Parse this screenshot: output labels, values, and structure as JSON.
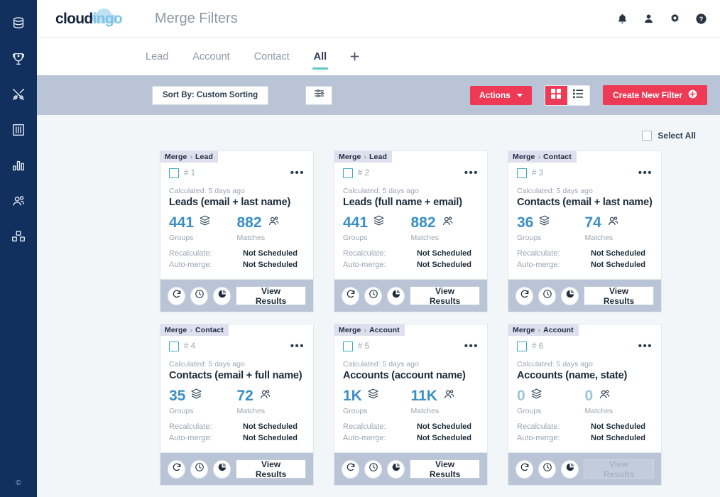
{
  "sidebar": {
    "items": [
      {
        "name": "database-icon",
        "label": "Data"
      },
      {
        "name": "shield-trophy-icon",
        "label": "Quality"
      },
      {
        "name": "tools-icon",
        "label": "Tools"
      },
      {
        "name": "books-icon",
        "label": "Library"
      },
      {
        "name": "bar-chart-icon",
        "label": "Reports"
      },
      {
        "name": "people-icon",
        "label": "Users"
      },
      {
        "name": "cubes-icon",
        "label": "Modules"
      }
    ],
    "copyright": "©"
  },
  "header": {
    "logo_primary": "cloud",
    "logo_secondary": "ingo",
    "title": "Merge Filters",
    "icons": [
      {
        "name": "bell-icon",
        "label": "Notifications"
      },
      {
        "name": "user-icon",
        "label": "Account"
      },
      {
        "name": "gear-icon",
        "label": "Settings"
      },
      {
        "name": "help-icon",
        "label": "Help"
      }
    ]
  },
  "tabs": {
    "items": [
      {
        "label": "Lead",
        "active": false
      },
      {
        "label": "Account",
        "active": false
      },
      {
        "label": "Contact",
        "active": false
      },
      {
        "label": "All",
        "active": true
      }
    ],
    "add_label": "+"
  },
  "toolbar": {
    "sort_label": "Sort By: Custom Sorting",
    "filter_icon": "sliders-icon",
    "actions_label": "Actions",
    "view_grid": "grid-view-icon",
    "view_list": "list-view-icon",
    "active_view": "grid",
    "create_label": "Create New Filter",
    "create_icon": "plus-circle-icon"
  },
  "content": {
    "select_all_label": "Select All",
    "labels": {
      "groups": "Groups",
      "matches": "Matches",
      "recalculate": "Recalculate:",
      "automerge": "Auto-merge:",
      "view_results": "View Results",
      "menu": "•••"
    },
    "footer_icons": [
      {
        "name": "refresh-icon"
      },
      {
        "name": "clock-icon"
      },
      {
        "name": "pie-chart-icon"
      }
    ],
    "cards": [
      {
        "badge_object": "Merge",
        "badge_sep": "›",
        "badge_type": "Lead",
        "number": "# 1",
        "calculated": "Calculated: 5 days ago",
        "title": "Leads (email + last name)",
        "groups": "441",
        "matches": "882",
        "recalculate": "Not Scheduled",
        "automerge": "Not Scheduled",
        "disabled": false
      },
      {
        "badge_object": "Merge",
        "badge_sep": "›",
        "badge_type": "Lead",
        "number": "# 2",
        "calculated": "Calculated: 5 days ago",
        "title": "Leads (full name + email)",
        "groups": "441",
        "matches": "882",
        "recalculate": "Not Scheduled",
        "automerge": "Not Scheduled",
        "disabled": false
      },
      {
        "badge_object": "Merge",
        "badge_sep": "›",
        "badge_type": "Contact",
        "number": "# 3",
        "calculated": "Calculated: 5 days ago",
        "title": "Contacts (email + last name)",
        "groups": "36",
        "matches": "74",
        "recalculate": "Not Scheduled",
        "automerge": "Not Scheduled",
        "disabled": false
      },
      {
        "badge_object": "Merge",
        "badge_sep": "›",
        "badge_type": "Contact",
        "number": "# 4",
        "calculated": "Calculated: 5 days ago",
        "title": "Contacts (email + full name)",
        "groups": "35",
        "matches": "72",
        "recalculate": "Not Scheduled",
        "automerge": "Not Scheduled",
        "disabled": false
      },
      {
        "badge_object": "Merge",
        "badge_sep": "›",
        "badge_type": "Account",
        "number": "# 5",
        "calculated": "Calculated: 5 days ago",
        "title": "Accounts (account name)",
        "groups": "1K",
        "matches": "11K",
        "recalculate": "Not Scheduled",
        "automerge": "Not Scheduled",
        "disabled": false
      },
      {
        "badge_object": "Merge",
        "badge_sep": "›",
        "badge_type": "Account",
        "number": "# 6",
        "calculated": "Calculated: 5 days ago",
        "title": "Accounts (name, state)",
        "groups": "0",
        "matches": "0",
        "recalculate": "Not Scheduled",
        "automerge": "Not Scheduled",
        "disabled": true
      }
    ]
  },
  "colors": {
    "sidebar": "#12305e",
    "accent_red": "#ee3a54",
    "toolbar_blue": "#b9c5d6",
    "stat_blue": "#3a8fc4",
    "tab_underline": "#5ec9bd",
    "page_bg": "#f2f6f9"
  }
}
